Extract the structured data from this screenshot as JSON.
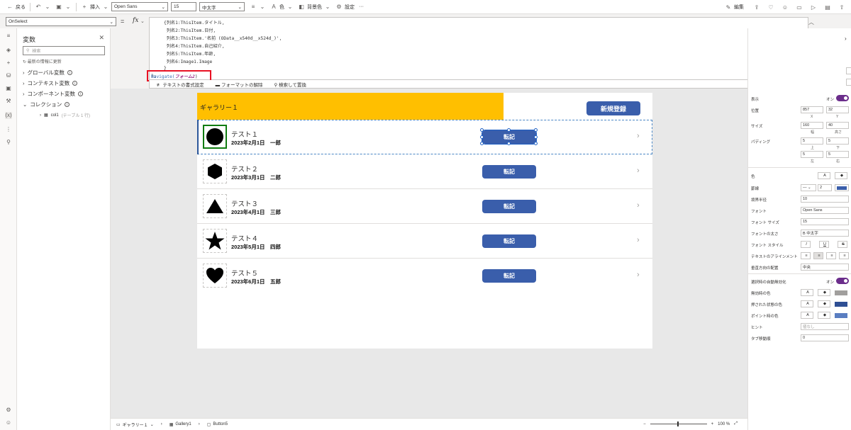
{
  "toolbar": {
    "back_label": "戻る",
    "insert_label": "挿入",
    "font_value": "Open Sans",
    "font_size_value": "15",
    "font_weight_value": "中太字",
    "color_label": "色",
    "bg_color_label": "背景色",
    "settings_label": "設定",
    "more_label": "···",
    "edit_label": "編集"
  },
  "formula": {
    "property": "OnSelect",
    "eq": "=",
    "fx": "fx",
    "lines": [
      "{列名1:ThisItem.タイトル,",
      " 列名2:ThisItem.日付,",
      " 列名3:ThisItem.'名前 (OData__x540d__x524d_)',",
      " 列名4:ThisItem.自己紹介,",
      " 列名5:ThisItem.年齢,",
      " 列名6:Image1.Image",
      "}"
    ],
    "close_line": ");",
    "navigate_fn": "Navigate(",
    "navigate_arg": "フォーム2",
    "navigate_end": ")",
    "fmt_label": "テキストの書式設定",
    "unfmt_label": "フォーマットの解除",
    "find_label": "検索して置換"
  },
  "variables_panel": {
    "title": "変数",
    "search_placeholder": "検索",
    "refresh_label": "最新の情報に更新",
    "global_label": "グローバル変数",
    "context_label": "コンテキスト変数",
    "component_label": "コンポーネント変数",
    "collection_label": "コレクション",
    "collection_item": "col1",
    "collection_item_meta": "(テーブル 1 行)"
  },
  "screen": {
    "header_title": "ギャラリー１",
    "new_button": "新規登録",
    "rows": [
      {
        "title": "テスト１",
        "subtitle": "2023年2月1日　一郎",
        "button": "転記",
        "shape": "circle"
      },
      {
        "title": "テスト２",
        "subtitle": "2023年3月1日　二郎",
        "button": "転記",
        "shape": "hexagon"
      },
      {
        "title": "テスト３",
        "subtitle": "2023年4月1日　三郎",
        "button": "転記",
        "shape": "triangle"
      },
      {
        "title": "テスト４",
        "subtitle": "2023年5月1日　四郎",
        "button": "転記",
        "shape": "star"
      },
      {
        "title": "テスト５",
        "subtitle": "2023年6月1日　五郎",
        "button": "転記",
        "shape": "heart"
      }
    ]
  },
  "props": {
    "display_label": "表示",
    "on_label": "オン",
    "position_label": "位置",
    "pos_x": "857",
    "pos_y": "32",
    "x_label": "X",
    "y_label": "Y",
    "size_label": "サイズ",
    "width": "160",
    "height": "40",
    "width_label": "幅",
    "height_label": "高さ",
    "padding_label": "パディング",
    "pad_top": "5",
    "pad_bottom": "5",
    "pad_left": "5",
    "pad_right": "5",
    "top_label": "上",
    "bottom_label": "下",
    "left_label": "左",
    "right_label": "右",
    "color_label": "色",
    "border_label": "罫線",
    "border_width": "2",
    "radius_label": "境界半径",
    "radius_value": "10",
    "font_label": "フォント",
    "font_value": "Open Sans",
    "font_size_label": "フォント サイズ",
    "font_size_value": "15",
    "weight_label": "フォントの太さ",
    "weight_value": "B 中太字",
    "style_label": "フォント スタイル",
    "align_label": "テキストのアラインメント",
    "valign_label": "垂直方向の配置",
    "valign_value": "中央",
    "autodisable_label": "選択時の自動無効化",
    "disabled_color_label": "無効時の色",
    "pressed_color_label": "押された状態の色",
    "hover_color_label": "ポイント時の色",
    "tooltip_label": "ヒント",
    "tooltip_value": "値なし",
    "tab_label": "タブ移動順",
    "tab_value": "0"
  },
  "status": {
    "screen_crumb": "ギャラリー１",
    "gallery_crumb": "Gallery1",
    "button_crumb": "Button5",
    "zoom_value": "100 %"
  },
  "colors": {
    "accent": "#3a5eab",
    "header_yellow": "#ffbf00",
    "toggle_purple": "#6b2d8b",
    "highlight_red": "#e81123"
  }
}
